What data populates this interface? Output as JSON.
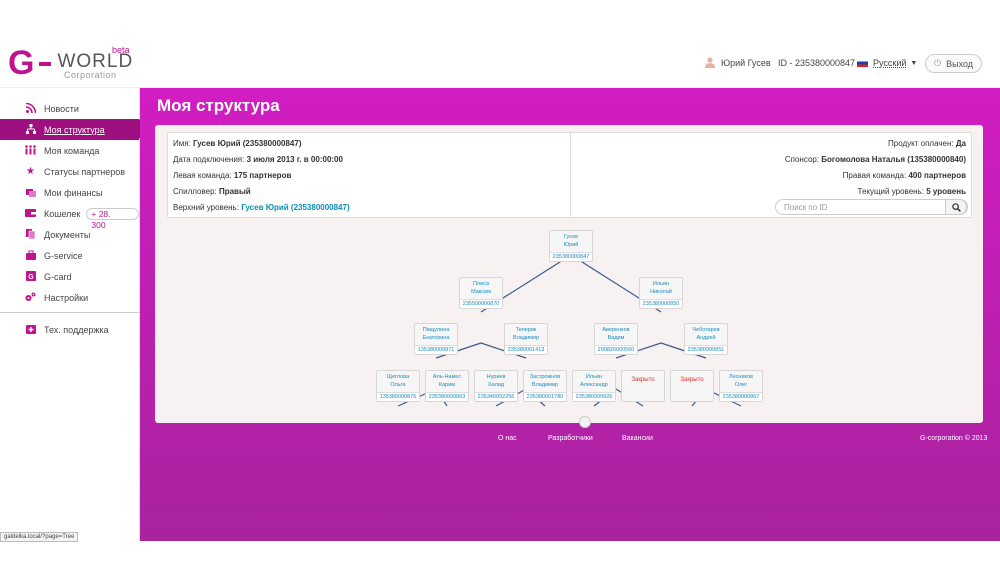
{
  "header": {
    "logo": {
      "g": "G",
      "world": "WORLD",
      "beta": "beta",
      "corp": "Corporation"
    },
    "user_name": "Юрий Гусев",
    "user_id": "ID - 235380000847",
    "language": "Русский",
    "logout": "Выход"
  },
  "sidebar": {
    "items": [
      {
        "label": "Новости",
        "icon": "rss-icon"
      },
      {
        "label": "Моя структура",
        "icon": "structure-icon",
        "active": true
      },
      {
        "label": "Моя команда",
        "icon": "team-icon"
      },
      {
        "label": "Статусы партнеров",
        "icon": "star-icon"
      },
      {
        "label": "Мои финансы",
        "icon": "finance-icon"
      },
      {
        "label": "Кошелек",
        "icon": "wallet-icon",
        "badge": "+ 28. 300"
      },
      {
        "label": "Документы",
        "icon": "documents-icon"
      },
      {
        "label": "G-service",
        "icon": "service-icon"
      },
      {
        "label": "G-card",
        "icon": "card-icon"
      },
      {
        "label": "Настройки",
        "icon": "settings-icon"
      }
    ],
    "support": {
      "label": "Тех. поддержка",
      "icon": "support-icon"
    }
  },
  "main": {
    "title": "Моя структура",
    "info": {
      "name_label": "Имя:",
      "name_value": "Гусев Юрий (235380000847)",
      "date_label": "Дата подключения:",
      "date_value": "3 июля 2013 г. в 00:00:00",
      "left_label": "Левая команда:",
      "left_value": "175 партнеров",
      "spill_label": "Спилловер:",
      "spill_value": "Правый",
      "upper_label": "Верхний уровень:",
      "upper_value": "Гусев Юрий (235380000847)",
      "paid_label": "Продукт оплачен:",
      "paid_value": "Да",
      "sponsor_label": "Спонсор:",
      "sponsor_value": "Богомолова Наталья (135380000840)",
      "right_label": "Правая команда:",
      "right_value": "400 партнеров",
      "level_label": "Текущий уровень:",
      "level_value": "5 уровень",
      "search_placeholder": "Поиск по ID"
    },
    "tree": [
      {
        "first": "Гусев",
        "last": "Юрий",
        "id": "235380000847"
      },
      {
        "first": "Плиса",
        "last": "Максим",
        "id": "235500000870"
      },
      {
        "first": "Ильин",
        "last": "Николай",
        "id": "235380000850"
      },
      {
        "first": "Пищулина",
        "last": "Екатерина",
        "id": "135380000871"
      },
      {
        "first": "Теперик",
        "last": "Владимир",
        "id": "235380001413"
      },
      {
        "first": "Аверенков",
        "last": "Вадим",
        "id": "290820000560"
      },
      {
        "first": "Чеботарев",
        "last": "Андрей",
        "id": "235380000851"
      },
      {
        "first": "Щеглова",
        "last": "Ольга",
        "id": "135380000876"
      },
      {
        "first": "Аль-Намес",
        "last": "Карим",
        "id": "235380000863"
      },
      {
        "first": "Нуриев",
        "last": "Халид",
        "id": "235340002256"
      },
      {
        "first": "Застрожнов",
        "last": "Владимир",
        "id": "235380001780"
      },
      {
        "first": "Ильин",
        "last": "Александр",
        "id": "235380000926"
      },
      {
        "closed": "Закрыто"
      },
      {
        "closed": "Закрыто"
      },
      {
        "first": "Лесников",
        "last": "Олег",
        "id": "235380000867"
      }
    ]
  },
  "footer": {
    "about": "О нас",
    "developers": "Разработчики",
    "vacancies": "Вакансии",
    "copyright": "G-corporation © 2013"
  },
  "statusbar": "galdelka.local/?page=Tree"
}
